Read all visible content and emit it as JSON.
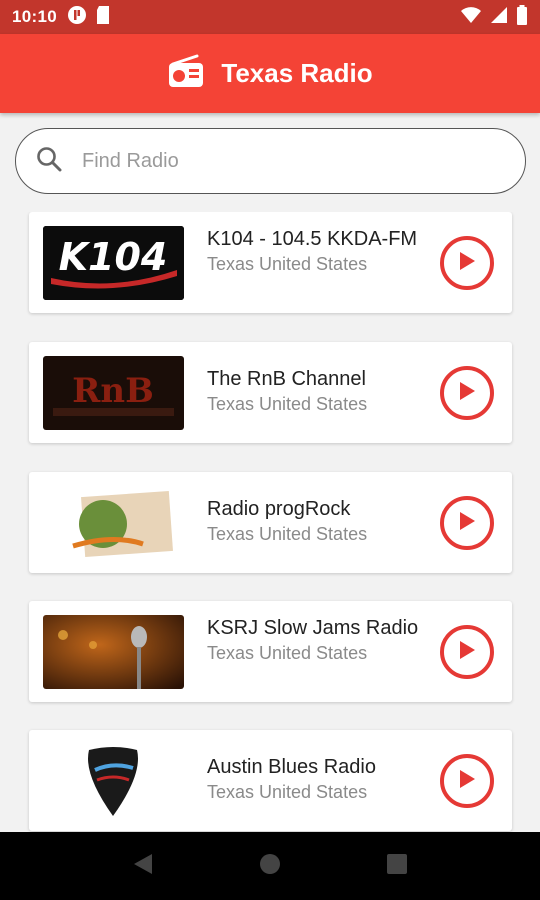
{
  "status_bar": {
    "time": "10:10",
    "icons": [
      "media-icon",
      "sd-card-icon",
      "wifi-icon",
      "signal-icon",
      "battery-icon"
    ]
  },
  "app_bar": {
    "title": "Texas Radio",
    "icon": "radio-icon",
    "color": "#f44336"
  },
  "search": {
    "placeholder": "Find Radio",
    "value": "",
    "icon": "search-icon"
  },
  "stations": [
    {
      "name": "K104 - 104.5 KKDA-FM",
      "location": "Texas United States",
      "logo": "k104-logo"
    },
    {
      "name": "The RnB Channel",
      "location": "Texas United States",
      "logo": "rnb-channel-logo"
    },
    {
      "name": "Radio progRock",
      "location": "Texas United States",
      "logo": "prog-rock-logo"
    },
    {
      "name": "KSRJ Slow Jams Radio",
      "location": "Texas United States",
      "logo": "microphone-logo"
    },
    {
      "name": "Austin Blues Radio",
      "location": "Texas United States",
      "logo": "austin-blues-logo"
    }
  ],
  "nav_bar": {
    "icons": [
      "back-icon",
      "home-icon",
      "recents-icon"
    ]
  },
  "colors": {
    "accent": "#f44336",
    "status_bar": "#c2362c",
    "play": "#e53935"
  }
}
